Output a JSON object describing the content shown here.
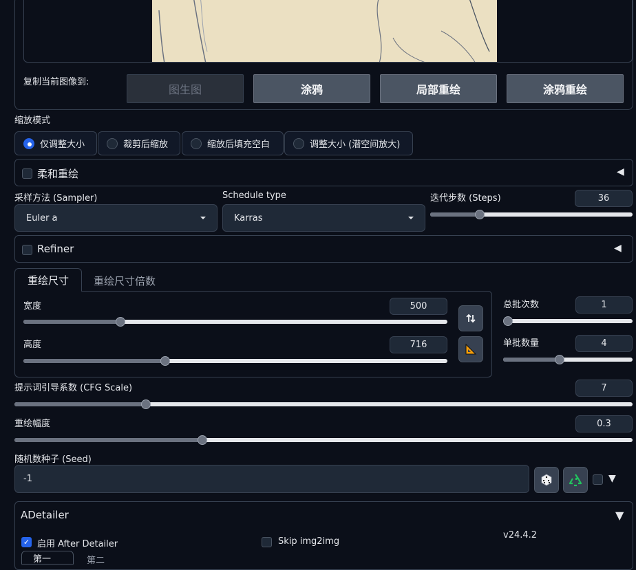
{
  "copy_section": {
    "label": "复制当前图像到:",
    "buttons": [
      "图生图",
      "涂鸦",
      "局部重绘",
      "涂鸦重绘"
    ]
  },
  "resize_mode": {
    "label": "缩放模式",
    "options": [
      "仅调整大小",
      "裁剪后缩放",
      "缩放后填充空白",
      "调整大小 (潜空间放大)"
    ],
    "selected": "仅调整大小"
  },
  "soft_inpaint": {
    "title": "柔和重绘",
    "checked": false,
    "arrow": "◀"
  },
  "sampler": {
    "label": "采样方法 (Sampler)",
    "value": "Euler a"
  },
  "schedule": {
    "label": "Schedule type",
    "value": "Karras"
  },
  "steps": {
    "label": "迭代步数 (Steps)",
    "value": "36",
    "fraction": 0.2
  },
  "refiner": {
    "title": "Refiner",
    "checked": false,
    "arrow": "◀"
  },
  "size_tabs": {
    "active": "重绘尺寸",
    "inactive": "重绘尺寸倍数"
  },
  "width": {
    "label": "宽度",
    "value": "500",
    "fraction": 0.23
  },
  "height": {
    "label": "高度",
    "value": "716",
    "fraction": 0.33
  },
  "batch_count": {
    "label": "总批次数",
    "value": "1",
    "fraction": 0.0
  },
  "batch_size": {
    "label": "单批数量",
    "value": "4",
    "fraction": 0.43
  },
  "cfg": {
    "label": "提示词引导系数 (CFG Scale)",
    "value": "7",
    "fraction": 0.21
  },
  "denoise": {
    "label": "重绘幅度",
    "value": "0.3",
    "fraction": 0.3
  },
  "seed": {
    "label": "随机数种子 (Seed)",
    "value": "-1",
    "arrow": "▼"
  },
  "adetailer": {
    "title": "ADetailer",
    "arrow": "▼",
    "enable_label": "启用 After Detailer",
    "enable_checked": true,
    "skip_label": "Skip img2img",
    "skip_checked": false,
    "version": "v24.4.2",
    "tab1": "第一",
    "tab2": "第二"
  }
}
